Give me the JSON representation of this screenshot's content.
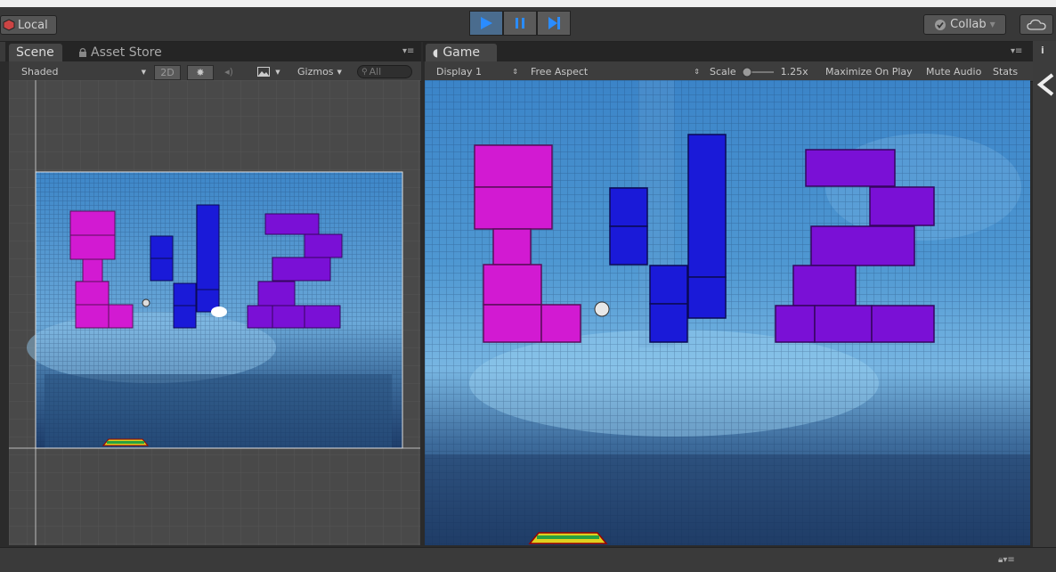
{
  "toolbar": {
    "local_label": "Local",
    "collab_label": "Collab",
    "play_icon": "play-icon",
    "pause_icon": "pause-icon",
    "step_icon": "step-icon",
    "cloud_icon": "cloud-icon"
  },
  "scene_panel": {
    "tabs": [
      {
        "label": "Scene",
        "active": true
      },
      {
        "label": "Asset Store",
        "active": false
      }
    ],
    "shading_mode": "Shaded",
    "mode_2d": "2D",
    "gizmos_label": "Gizmos",
    "search_placeholder": "All"
  },
  "game_panel": {
    "tab_label": "Game",
    "display": "Display 1",
    "aspect": "Free Aspect",
    "scale_label": "Scale",
    "scale_value": "1.25x",
    "maximize_label": "Maximize On Play",
    "mute_label": "Mute Audio",
    "stats_label": "Stats"
  },
  "colors": {
    "magenta": "#d21ad2",
    "blue": "#1a1ad8",
    "purple": "#7a10d6",
    "sky": "#3a7bc0",
    "play_blue": "#2a8cff"
  }
}
